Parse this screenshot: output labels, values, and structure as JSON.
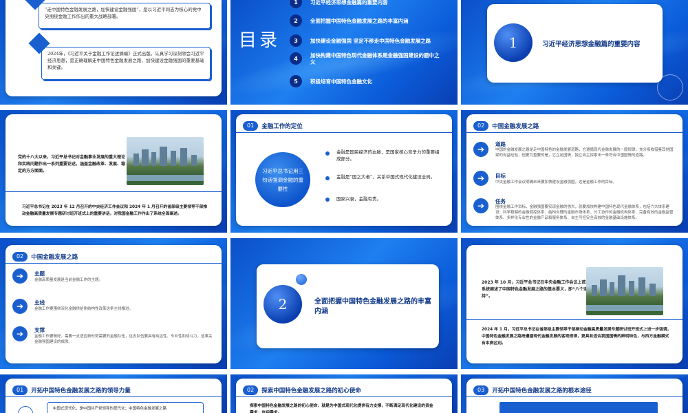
{
  "slides": {
    "s1": {
      "paragraph1": "“走中国特色金融发展之路，加快建设金融强国”，是以习近平同志为核心的党中央围绕金融工作作出的重大战略部署。",
      "paragraph2": "2024年，《习近平关于金融工作论述摘编》正式出版。认真学习深刻领会习近平经济思想，是正确理解走中国特色金融发展之路、加快建设金融强国的重要基础和关键。"
    },
    "s2": {
      "title": "目录",
      "items": [
        {
          "num": "1",
          "label": "习近平经济思想金融篇的重要内容"
        },
        {
          "num": "2",
          "label": "全面把握中国特色金融发展之路的丰富内涵"
        },
        {
          "num": "3",
          "label": "加快建设金融强国 坚定不移走中国特色金融发展之路"
        },
        {
          "num": "4",
          "label": "加快构建中国特色现代金融体系是金融强国建设的题中之义"
        },
        {
          "num": "5",
          "label": "积极培育中国特色金融文化"
        }
      ]
    },
    "s3": {
      "num": "1",
      "title": "习近平经济思想金融篇的重要内容"
    },
    "s4": {
      "text1": "党的十八大以来，习近平总书记对金融事业发展的重大理论和实践问题作出一系列重要论述，涵盖金融改革、发展、稳定的方方面面。",
      "text2": "习近平总书记在 2023 年 12 月召开的中央经济工作会议和 2024 年 1 月召开的省部级主要领导干部推动金融高质量发展专题研讨班开班式上的重要讲话，对我国金融工作作出了系统全面阐述。"
    },
    "s5": {
      "num": "01",
      "header": "金融工作的定位",
      "circle": "习近平总书记用三句话强调金融的重要性",
      "points": [
        "金融是国民经济的血脉，是国家核心竞争力的重要组成部分。",
        "金融是“国之大者”，关系中国式现代化建设全局。",
        "国家兴衰，金融有责。"
      ]
    },
    "s6": {
      "num": "02",
      "header": "中国金融发展之路",
      "items": [
        {
          "title": "道路",
          "text": "中国的金融发展之路是走中国特色的金融发展道路，它遵循现代金融发展的一般规律，充分吸收借鉴其他国家的有益经验，但更为重要的是，它立足国情，独立自主探索出一条符合中国国情的道路。"
        },
        {
          "title": "目标",
          "text": "中央金融工作会议明确未来要加快建设金融强国，这是金融工作的目标。"
        },
        {
          "title": "任务",
          "text": "围绕金融工作目标，金融强国要实现金融的强大，就要加快构建中国特色现代金融体系，包括六大体系建设：科学稳健的金融调控体系、结构合理的金融市场体系、分工协作的金融机构体系、完备有效的金融监管体系、多样化专业性的金融产品和服务体系、自主可控安全高效的金融基础设施体系。"
        }
      ]
    },
    "s7": {
      "num": "02",
      "header": "中国金融发展之路",
      "items": [
        {
          "title": "主题",
          "text": "金融高质量发展是当前金融工作的主题。"
        },
        {
          "title": "主线",
          "text": "金融工作要围绕深化金融供给侧结构性改革这条主线推进。"
        },
        {
          "title": "支撑",
          "text": "金融工作要做好，需要一支适应新形势需要的金融队伍，这支队伍要具有纯洁性、专业性和战斗力，这事关金融强国建设的成败。"
        }
      ]
    },
    "s8": {
      "num": "2",
      "title": "全面把握中国特色金融发展之路的丰富内涵"
    },
    "s9": {
      "text1": "2023 年 10 月，习近平总书记在中央金融工作会议上首次系统阐述了中国特色金融发展之路的基本要义，即“八个坚持”。",
      "text2": "2024 年 1 月，习近平总书记在省部级主要领导干部推动金融高质量发展专题研讨班开班式上进一步强调，中国特色金融发展之路既遵循现代金融发展的客观规律，更具有适合我国国情的鲜明特色，与西方金融模式有本质区别。"
    },
    "s10": {
      "num": "01",
      "header": "开拓中国特色金融发展之路的领导力量",
      "text": "中国式现代化，是中国共产党领导的现代化；中国特色金融发展之路"
    },
    "s11": {
      "num": "02",
      "header": "探索中国特色金融发展之路的初心使命",
      "text": "探索中国特色金融发展之路的初心使命，就是为中国式现代化提供有力支撑，不断满足现代化建设的资金需求，信用需求。"
    },
    "s12": {
      "num": "03",
      "header": "开拓中国特色金融发展之路的根本途径"
    },
    "colors": {
      "accent": "#1a5fd0",
      "dark": "#123a8a",
      "bg_blue": "#0f62e0"
    }
  }
}
